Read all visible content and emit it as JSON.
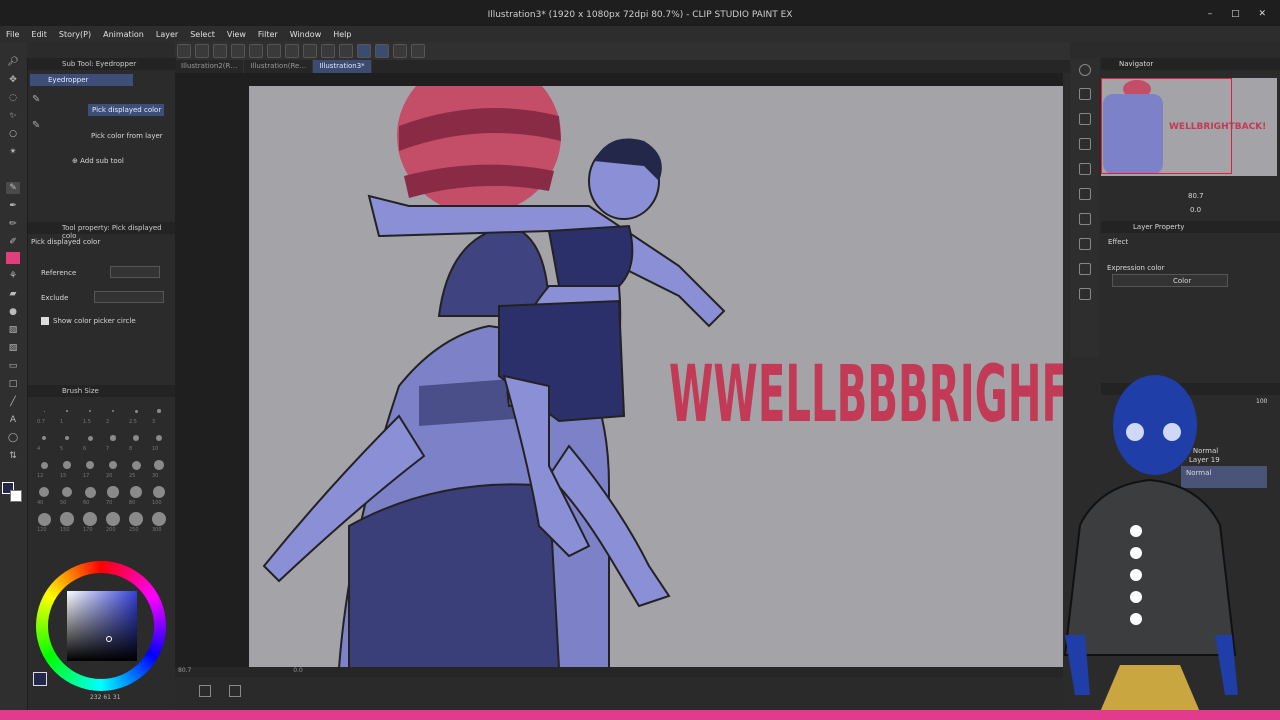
{
  "window": {
    "title": "Illustration3* (1920 x 1080px 72dpi 80.7%) - CLIP STUDIO PAINT EX",
    "controls": "– □ ✕"
  },
  "menu": [
    "File",
    "Edit",
    "Story(P)",
    "Animation",
    "Layer",
    "Select",
    "View",
    "Filter",
    "Window",
    "Help"
  ],
  "tabs": [
    {
      "label": "Illustration2(R…"
    },
    {
      "label": "Illustration(Re…"
    },
    {
      "label": "Illustration3*"
    }
  ],
  "subtool": {
    "header": "Sub Tool: Eyedropper",
    "group": "Eyedropper",
    "items": [
      "Pick displayed color",
      "Pick color from layer"
    ],
    "add_label": "Add sub tool"
  },
  "tool_property": {
    "header": "Tool property: Pick displayed colo",
    "name": "Pick displayed color",
    "reference_label": "Reference",
    "exclude_label": "Exclude",
    "circle_label": "Show color picker circle"
  },
  "brush_size": {
    "header": "Brush Size",
    "sizes": [
      "0.7",
      "1",
      "1.5",
      "2",
      "2.5",
      "3",
      "4",
      "5",
      "6",
      "7",
      "8",
      "10",
      "12",
      "15",
      "17",
      "20",
      "25",
      "30",
      "40",
      "50",
      "60",
      "70",
      "80",
      "100",
      "120",
      "150",
      "170",
      "200",
      "250",
      "300"
    ]
  },
  "color": {
    "rgb_readout": "232 61 31",
    "main": "#23284a",
    "sub": "#ffffff"
  },
  "status": {
    "zoom": "80.7",
    "rotation": "0.0"
  },
  "navigator": {
    "header": "Navigator",
    "zoom": "80.7",
    "angle": "0.0",
    "thumb_text": "WELLBRIGHTBACK!"
  },
  "layer_property": {
    "header": "Layer Property",
    "effect_label": "Effect",
    "expression_label": "Expression color",
    "expression_value": "Color"
  },
  "layers": {
    "blend_top": "% Normal",
    "layer_name": "Layer 19",
    "blend_selected": "Normal",
    "opacity": "100"
  },
  "canvas": {
    "sign_text": "WWELLBBBRIGHF"
  }
}
